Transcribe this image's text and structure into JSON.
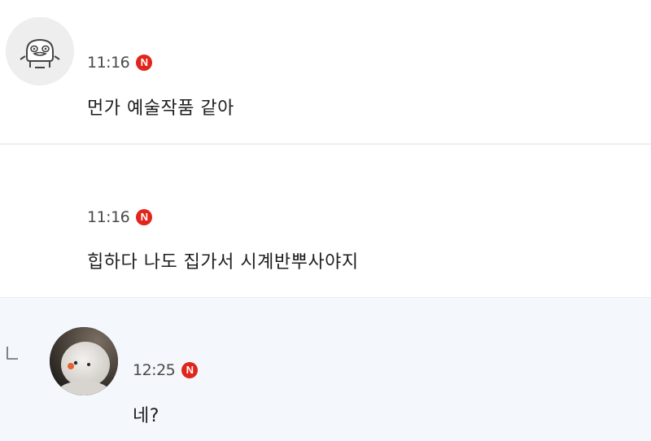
{
  "comments": [
    {
      "time": "11:16",
      "badge": "N",
      "text": "먼가 예술작품 같아",
      "avatar": "duck-character-avatar"
    },
    {
      "time": "11:16",
      "badge": "N",
      "text": "힙하다 나도 집가서 시계반뿌사야지"
    }
  ],
  "reply": {
    "time": "12:25",
    "badge": "N",
    "text": "네?",
    "avatar": "snowman-plush-avatar"
  },
  "colors": {
    "badge": "#e1251b",
    "reply_background": "#f4f7fb",
    "divider": "#eeeeee"
  }
}
